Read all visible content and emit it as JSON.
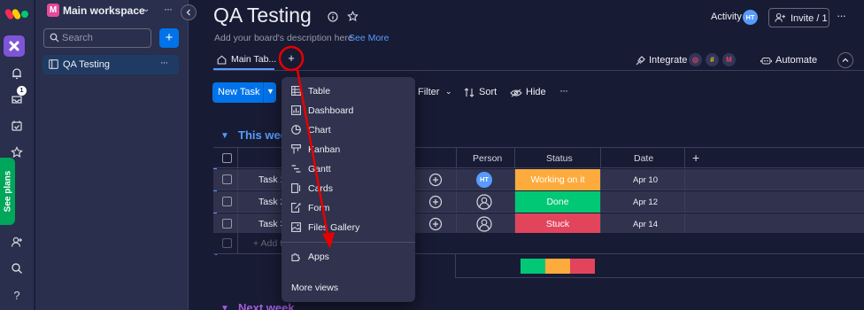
{
  "rail": {
    "inbox_badge": "1",
    "see_plans": "See plans",
    "icons": [
      "notifications-icon",
      "inbox-icon",
      "my-work-icon",
      "favorites-icon",
      "invite-members-icon",
      "search-icon",
      "help-icon"
    ]
  },
  "sidebar": {
    "workspace_initial": "M",
    "workspace_name": "Main workspace",
    "search_placeholder": "Search",
    "add_label": "+",
    "board_name": "QA Testing"
  },
  "header": {
    "title": "QA Testing",
    "description_placeholder": "Add your board's description here",
    "see_more": "See More",
    "activity": "Activity",
    "activity_avatar": "HT",
    "invite": "Invite / 1"
  },
  "tabs": {
    "main_tab": "Main Tab...",
    "add_tab": "+",
    "integrate": "Integrate",
    "integrate_logo_m": "M",
    "automate": "Automate"
  },
  "toolbar": {
    "new_task": "New Task",
    "filter": "Filter",
    "sort": "Sort",
    "hide": "Hide"
  },
  "groups": [
    {
      "title": "This week",
      "color": "#579bfc"
    },
    {
      "title": "Next week",
      "color": "#a25ddc"
    }
  ],
  "table": {
    "columns": {
      "person": "Person",
      "status": "Status",
      "date": "Date"
    },
    "rows": [
      {
        "task": "Task 1",
        "person": "HT",
        "status": "Working on it",
        "status_color": "#fdab3d",
        "date": "Apr 10"
      },
      {
        "task": "Task 2",
        "person": "",
        "status": "Done",
        "status_color": "#00c875",
        "date": "Apr 12"
      },
      {
        "task": "Task 3",
        "person": "",
        "status": "Stuck",
        "status_color": "#e2445c",
        "date": "Apr 14"
      }
    ],
    "add_task": "+ Add t",
    "status_summary": [
      {
        "status": "Done",
        "color": "#00c875",
        "share": 0.333
      },
      {
        "status": "Working on it",
        "color": "#fdab3d",
        "share": 0.333
      },
      {
        "status": "Stuck",
        "color": "#e2445c",
        "share": 0.334
      }
    ]
  },
  "add_view_menu": {
    "items": [
      {
        "label": "Table",
        "icon": "table-icon"
      },
      {
        "label": "Dashboard",
        "icon": "dashboard-icon"
      },
      {
        "label": "Chart",
        "icon": "chart-icon"
      },
      {
        "label": "Kanban",
        "icon": "kanban-icon"
      },
      {
        "label": "Gantt",
        "icon": "gantt-icon"
      },
      {
        "label": "Cards",
        "icon": "cards-icon"
      },
      {
        "label": "Form",
        "icon": "form-icon"
      },
      {
        "label": "Files Gallery",
        "icon": "files-gallery-icon"
      },
      {
        "label": "Apps",
        "icon": "apps-icon"
      }
    ],
    "more_views": "More views"
  },
  "annotation_color": "#e60000"
}
